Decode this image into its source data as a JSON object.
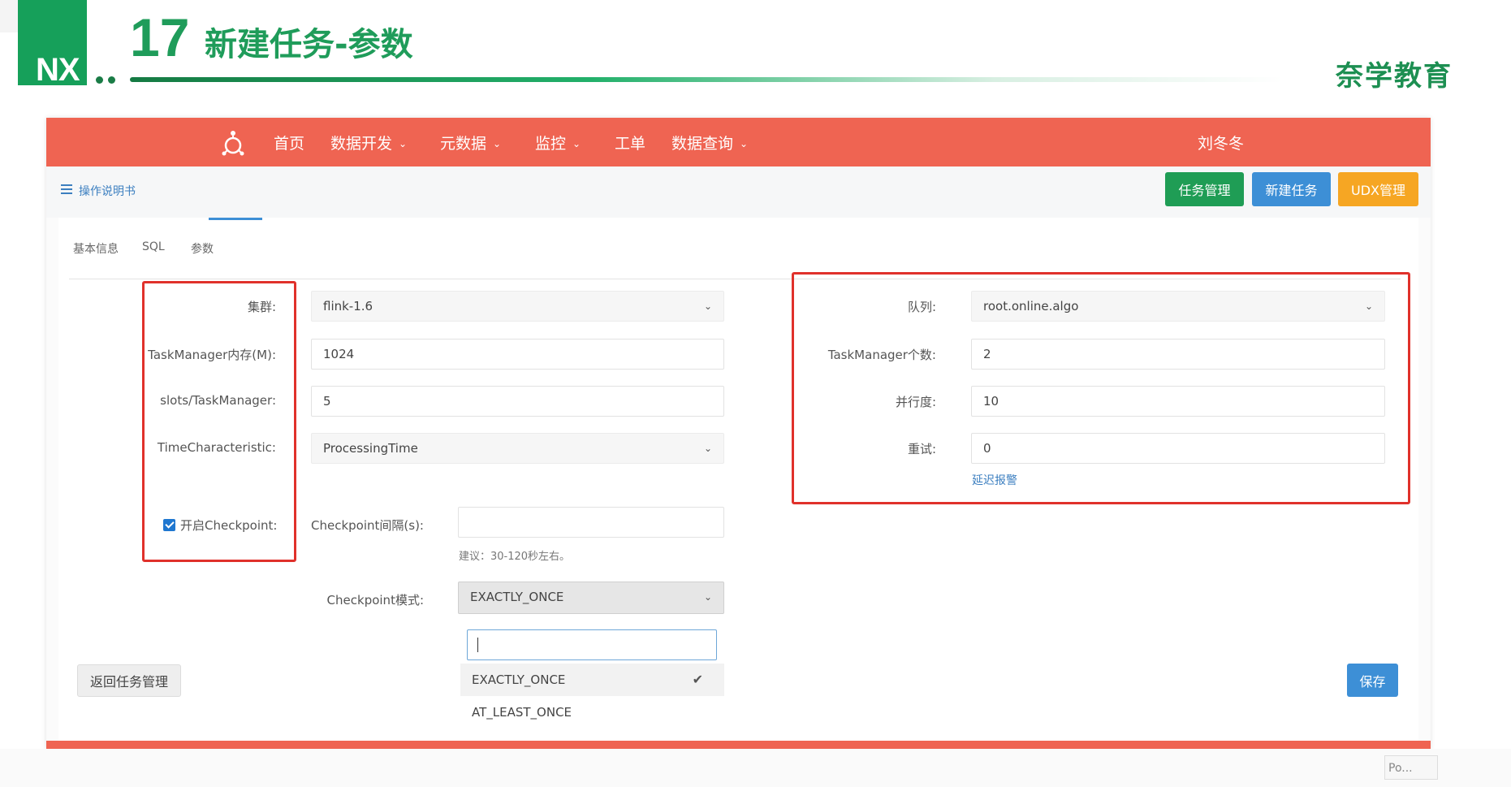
{
  "slide": {
    "number": "17",
    "title": "新建任务-参数",
    "logo": "NX",
    "brand": "奈学教育"
  },
  "nav": {
    "items": [
      {
        "label": "首页",
        "dropdown": false
      },
      {
        "label": "数据开发",
        "dropdown": true
      },
      {
        "label": "元数据",
        "dropdown": true
      },
      {
        "label": "监控",
        "dropdown": true
      },
      {
        "label": "工单",
        "dropdown": false
      },
      {
        "label": "数据查询",
        "dropdown": true
      }
    ],
    "user": "刘冬冬"
  },
  "subbar": {
    "manual": "操作说明书",
    "buttons": {
      "task_manage": "任务管理",
      "new_task": "新建任务",
      "udx_manage": "UDX管理"
    }
  },
  "tabs": [
    "基本信息",
    "SQL",
    "参数"
  ],
  "form": {
    "left": {
      "cluster": {
        "label": "集群:",
        "value": "flink-1.6"
      },
      "tm_memory": {
        "label": "TaskManager内存(M):",
        "value": "1024"
      },
      "slots": {
        "label": "slots/TaskManager:",
        "value": "5"
      },
      "time_characteristic": {
        "label": "TimeCharacteristic:",
        "value": "ProcessingTime"
      },
      "checkpoint_enable": {
        "label": "开启Checkpoint:",
        "checked": true
      },
      "checkpoint_interval": {
        "label": "Checkpoint间隔(s):",
        "value": "",
        "hint": "建议：30-120秒左右。"
      },
      "checkpoint_mode": {
        "label": "Checkpoint模式:",
        "value": "EXACTLY_ONCE",
        "options": [
          "EXACTLY_ONCE",
          "AT_LEAST_ONCE"
        ]
      }
    },
    "right": {
      "queue": {
        "label": "队列:",
        "value": "root.online.algo"
      },
      "tm_count": {
        "label": "TaskManager个数:",
        "value": "2"
      },
      "parallelism": {
        "label": "并行度:",
        "value": "10"
      },
      "retry": {
        "label": "重试:",
        "value": "0"
      },
      "delay_alert": "延迟报警"
    }
  },
  "actions": {
    "back": "返回任务管理",
    "save": "保存"
  },
  "corner_box": "Po...",
  "colors": {
    "nav": "#ef6452",
    "green": "#1f9d55",
    "blue": "#3d8fd6",
    "orange": "#f6a623",
    "highlight": "#e0312b",
    "brand": "#1f9c5a"
  }
}
